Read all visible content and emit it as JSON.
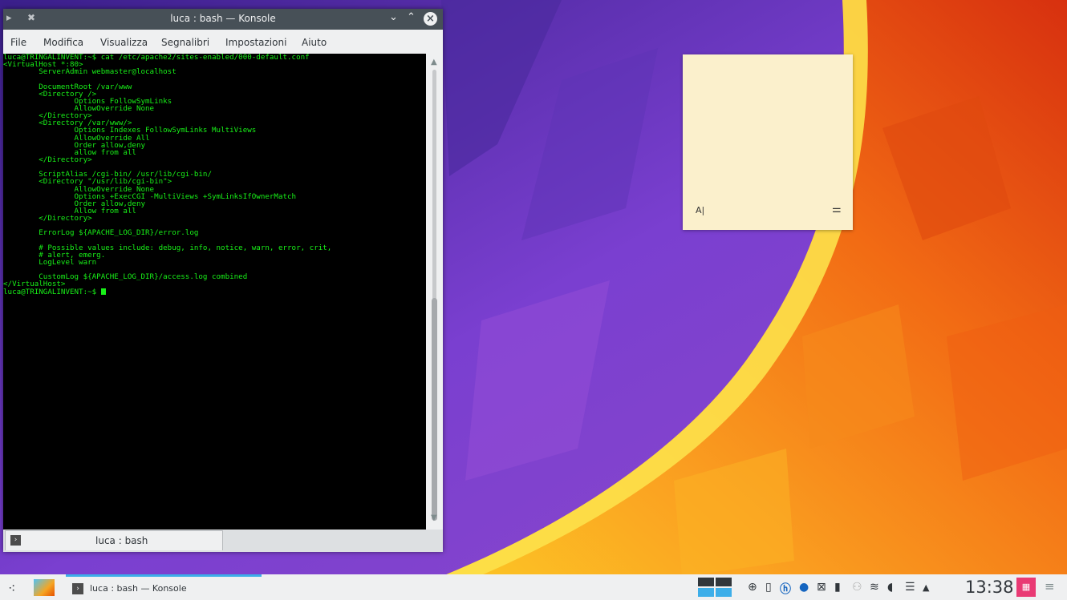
{
  "window": {
    "title": "luca : bash — Konsole",
    "icons": {
      "app": "terminal-icon",
      "pin": "pin-icon",
      "minimize": "chevron-down-icon",
      "maximize": "chevron-up-icon",
      "close": "close-icon"
    }
  },
  "menu": {
    "file": "File",
    "edit": "Modifica",
    "view": "Visualizza",
    "bookmarks": "Segnalibri",
    "settings": "Impostazioni",
    "help": "Aiuto"
  },
  "terminal": {
    "lines": [
      "luca@TRINGALINVENT:~$ cat /etc/apache2/sites-enabled/000-default.conf",
      "<VirtualHost *:80>",
      "        ServerAdmin webmaster@localhost",
      "",
      "        DocumentRoot /var/www",
      "        <Directory />",
      "                Options FollowSymLinks",
      "                AllowOverride None",
      "        </Directory>",
      "        <Directory /var/www/>",
      "                Options Indexes FollowSymLinks MultiViews",
      "                AllowOverride All",
      "                Order allow,deny",
      "                allow from all",
      "        </Directory>",
      "",
      "        ScriptAlias /cgi-bin/ /usr/lib/cgi-bin/",
      "        <Directory \"/usr/lib/cgi-bin\">",
      "                AllowOverride None",
      "                Options +ExecCGI -MultiViews +SymLinksIfOwnerMatch",
      "                Order allow,deny",
      "                Allow from all",
      "        </Directory>",
      "",
      "        ErrorLog ${APACHE_LOG_DIR}/error.log",
      "",
      "        # Possible values include: debug, info, notice, warn, error, crit,",
      "        # alert, emerg.",
      "        LogLevel warn",
      "",
      "        CustomLog ${APACHE_LOG_DIR}/access.log combined",
      "</VirtualHost>"
    ],
    "prompt": "luca@TRINGALINVENT:~$ ",
    "text_color": "#18f018",
    "background": "#000000"
  },
  "tab": {
    "label": "luca : bash"
  },
  "note": {
    "format_label": "A",
    "config_icon": "settings-sliders-icon"
  },
  "taskbar": {
    "task_label": "luca : bash — Konsole",
    "clock": "13:38",
    "accent": "#3daee9"
  }
}
